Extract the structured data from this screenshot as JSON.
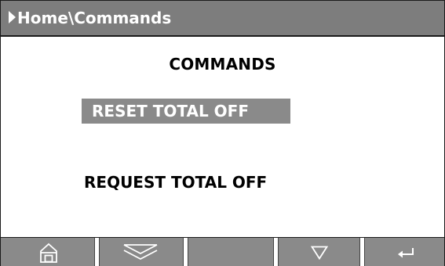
{
  "header": {
    "breadcrumb": "Home\\Commands",
    "arrow_icon": "right-triangle-icon"
  },
  "main": {
    "title": "COMMANDS",
    "commands": [
      {
        "label": "RESET TOTAL OFF",
        "selected": true
      },
      {
        "label": "REQUEST TOTAL OFF",
        "selected": false
      }
    ]
  },
  "softkeys": [
    {
      "icon": "home-icon"
    },
    {
      "icon": "double-chevron-down-icon"
    },
    {
      "icon": ""
    },
    {
      "icon": "triangle-down-icon"
    },
    {
      "icon": "enter-icon"
    }
  ],
  "colors": {
    "header_bg": "#7d7d7d",
    "selection_bg": "#8a8a8a",
    "softkey_bg": "#8a8a8a",
    "text_light": "#ffffff",
    "text_dark": "#000000"
  }
}
